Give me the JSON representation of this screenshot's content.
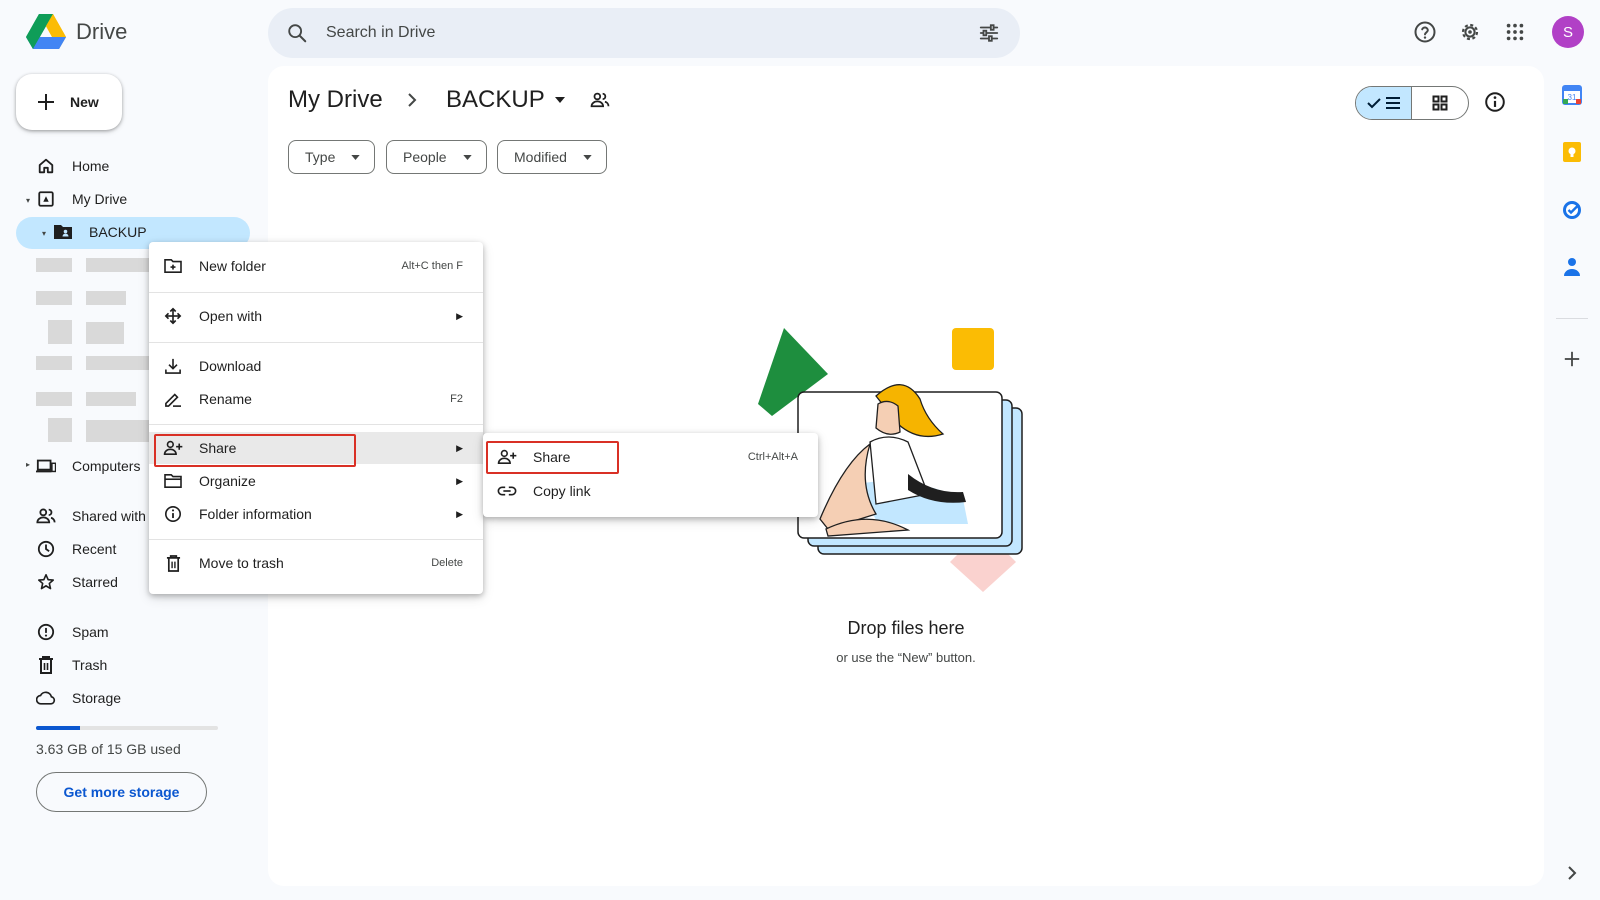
{
  "app": {
    "name": "Drive"
  },
  "search": {
    "placeholder": "Search in Drive"
  },
  "account": {
    "initial": "S"
  },
  "sidebar": {
    "new_label": "New",
    "items": [
      {
        "label": "Home",
        "icon": "home-icon"
      },
      {
        "label": "My Drive",
        "icon": "my-drive-icon"
      },
      {
        "label": "BACKUP",
        "icon": "shared-folder-icon"
      },
      {
        "label": "Computers",
        "icon": "computer-icon"
      },
      {
        "label": "Shared with me",
        "icon": "people-icon"
      },
      {
        "label": "Recent",
        "icon": "clock-icon"
      },
      {
        "label": "Starred",
        "icon": "star-icon"
      },
      {
        "label": "Spam",
        "icon": "spam-icon"
      },
      {
        "label": "Trash",
        "icon": "trash-icon"
      },
      {
        "label": "Storage",
        "icon": "cloud-icon"
      }
    ],
    "storage": {
      "used_text": "3.63 GB of 15 GB used",
      "used_fraction": 0.242,
      "cta": "Get more storage"
    }
  },
  "main": {
    "breadcrumb": {
      "root": "My Drive",
      "current": "BACKUP"
    },
    "filters": [
      "Type",
      "People",
      "Modified"
    ],
    "empty_state": {
      "title": "Drop files here",
      "subtitle": "or use the “New” button."
    }
  },
  "context_menu": {
    "items": [
      {
        "label": "New folder",
        "shortcut": "Alt+C then F",
        "icon": "new-folder-icon"
      },
      {
        "label": "Open with",
        "submenu": true,
        "icon": "open-with-icon"
      },
      {
        "label": "Download",
        "icon": "download-icon"
      },
      {
        "label": "Rename",
        "shortcut": "F2",
        "icon": "rename-icon"
      },
      {
        "label": "Share",
        "submenu": true,
        "icon": "share-icon",
        "highlighted": true
      },
      {
        "label": "Organize",
        "submenu": true,
        "icon": "organize-icon"
      },
      {
        "label": "Folder information",
        "submenu": true,
        "icon": "info-icon"
      },
      {
        "label": "Move to trash",
        "shortcut": "Delete",
        "icon": "trash-icon"
      }
    ]
  },
  "share_submenu": {
    "items": [
      {
        "label": "Share",
        "shortcut": "Ctrl+Alt+A",
        "icon": "share-icon"
      },
      {
        "label": "Copy link",
        "icon": "link-icon"
      }
    ]
  },
  "colors": {
    "accent": "#0b57d0",
    "selected": "#c2e7ff",
    "highlight_box": "#d93025",
    "avatar": "#b140c6"
  }
}
